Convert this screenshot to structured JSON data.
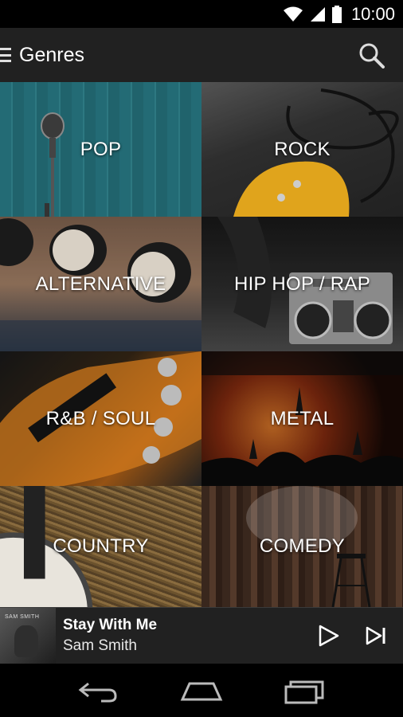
{
  "status_bar": {
    "time": "10:00"
  },
  "app_bar": {
    "title": "Genres"
  },
  "genres": [
    {
      "label": "POP"
    },
    {
      "label": "ROCK"
    },
    {
      "label": "ALTERNATIVE"
    },
    {
      "label": "HIP HOP / RAP"
    },
    {
      "label": "R&B / SOUL"
    },
    {
      "label": "METAL"
    },
    {
      "label": "COUNTRY"
    },
    {
      "label": "COMEDY"
    }
  ],
  "now_playing": {
    "title": "Stay With Me",
    "artist": "Sam Smith",
    "album_art_text": "SAM SMITH"
  },
  "icons": {
    "menu": "menu-icon",
    "search": "search-icon",
    "play": "play-icon",
    "next": "skip-next-icon",
    "back": "back-icon",
    "home": "home-icon",
    "recents": "recents-icon"
  }
}
